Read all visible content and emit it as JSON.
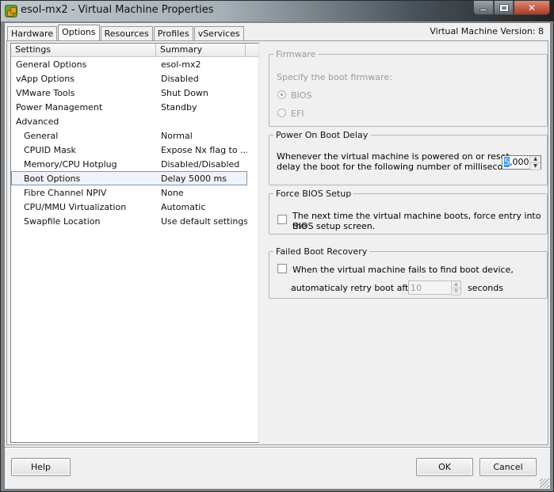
{
  "window": {
    "title": "esol-mx2 - Virtual Machine Properties",
    "app_icon": "vsphere-client-icon",
    "controls": {
      "minimize": "minimize-icon",
      "maximize": "maximize-icon",
      "close": "close-icon"
    }
  },
  "tabs": [
    {
      "label": "Hardware",
      "active": false
    },
    {
      "label": "Options",
      "active": true
    },
    {
      "label": "Resources",
      "active": false
    },
    {
      "label": "Profiles",
      "active": false
    },
    {
      "label": "vServices",
      "active": false
    }
  ],
  "vm_version": "Virtual Machine Version: 8",
  "settings_list": {
    "headers": {
      "settings": "Settings",
      "summary": "Summary"
    },
    "rows": [
      {
        "name": "General Options",
        "value": "esol-mx2",
        "indent": false,
        "selected": false
      },
      {
        "name": "vApp Options",
        "value": "Disabled",
        "indent": false,
        "selected": false
      },
      {
        "name": "VMware Tools",
        "value": "Shut Down",
        "indent": false,
        "selected": false
      },
      {
        "name": "Power Management",
        "value": "Standby",
        "indent": false,
        "selected": false
      },
      {
        "name": "Advanced",
        "value": "",
        "indent": false,
        "selected": false
      },
      {
        "name": "General",
        "value": "Normal",
        "indent": true,
        "selected": false
      },
      {
        "name": "CPUID Mask",
        "value": "Expose Nx flag to ...",
        "indent": true,
        "selected": false
      },
      {
        "name": "Memory/CPU Hotplug",
        "value": "Disabled/Disabled",
        "indent": true,
        "selected": false
      },
      {
        "name": "Boot Options",
        "value": "Delay 5000 ms",
        "indent": true,
        "selected": true
      },
      {
        "name": "Fibre Channel NPIV",
        "value": "None",
        "indent": true,
        "selected": false
      },
      {
        "name": "CPU/MMU Virtualization",
        "value": "Automatic",
        "indent": true,
        "selected": false
      },
      {
        "name": "Swapfile Location",
        "value": "Use default settings",
        "indent": true,
        "selected": false
      }
    ]
  },
  "firmware": {
    "legend": "Firmware",
    "prompt": "Specify the boot firmware:",
    "options": [
      {
        "label": "BIOS",
        "checked": true,
        "disabled": true
      },
      {
        "label": "EFI",
        "checked": false,
        "disabled": true
      }
    ]
  },
  "boot_delay": {
    "legend": "Power On Boot Delay",
    "line1": "Whenever the virtual machine is powered on or reset,",
    "line2": "delay the boot for the following number of milliseconds:",
    "value_selected_part": "5",
    "value_rest": ",000",
    "value": "5,000"
  },
  "force_bios": {
    "legend": "Force BIOS Setup",
    "checked": false,
    "line1": "The next time the virtual machine boots, force entry into the",
    "line2": "BIOS setup screen."
  },
  "failed_recovery": {
    "legend": "Failed Boot Recovery",
    "checked": false,
    "line1": "When the virtual machine fails to find boot device,",
    "retry_label": "automaticaly retry boot after",
    "retry_value": "10",
    "retry_unit": "seconds"
  },
  "buttons": {
    "help": "Help",
    "ok": "OK",
    "cancel": "Cancel"
  }
}
